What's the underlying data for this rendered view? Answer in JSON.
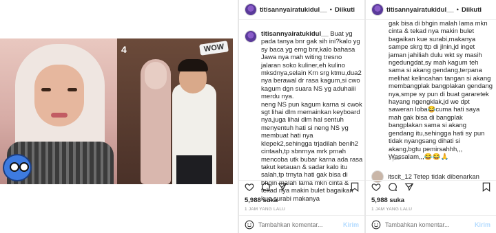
{
  "photo": {
    "panel_number": "4",
    "sticker": "WOW"
  },
  "post_a": {
    "username": "titisannyairatukidul__",
    "follow_label": "Diikuti",
    "caption_user": "titisannyairatukidul__",
    "caption": " Buat yg pada tanya bnr gak sih ini?kalo yg sy baca yg emg bnr,kalo bahasa Jawa nya mah witing tresno jalaran soko kuliner,eh kulino mksdnya,selain Krn srg ktmu,dua2 nya berawal dr rasa kagum,si cwo kagum dgn suara NS yg aduhaiii merdu nya.\nneng NS pun kagum karna si cwok sgt lihai dlm memainkan keyboard nya,juga lihai dlm hal sentuh menyentuh hati si neng NS yg membuat hati nya klepek2,sehingga trjadilah benih2 cintaah,tp sbnrnya mrk prnah mencoba utk bubar karna ada rasa takut ketauan & sadar kalo itu salah,tp trnyta hati gak bisa di bhgin malah lama mkn cinta & tekad nya makin bulet bagaikan kue surabi makanya",
    "likes": "5,988 suka",
    "time": "1 JAM YANG LALU",
    "add_comment_placeholder": "Tambahkan komentar...",
    "send_label": "Kirim"
  },
  "post_b": {
    "username": "titisannyairatukidul__",
    "follow_label": "Diikuti",
    "caption_cont": "gak bisa di bhgin malah lama mkn cinta & tekad nya makin bulet bagaikan kue surabi,makanya sampe skrg ttp di jlnin,jd inget jaman jahiliah dulu wkt sy masih ngedungdat,sy mah kagum teh sama si akang gendang,terpana melihat kelincahan tangan si akang membangplak bangplakan gendang nya,smpe sy pun di buat gararetek hayang ngengklak,jd we dpt saweran loba😂cuma hati saya mah gak bisa di bangplak bangplakan sama si akang gendang itu,sehingga hati sy pun tidak nyangsang dihati si akang,bgtu pemirsahhh,,,\nWassalam,,,😂😂🙏",
    "time_small": "1 jam",
    "comment": "itscit_12 Tetep tidak dibenarkan",
    "likes": "5,988 suka",
    "time": "1 JAM YANG LALU",
    "add_comment_placeholder": "Tambahkan komentar...",
    "send_label": "Kirim"
  }
}
